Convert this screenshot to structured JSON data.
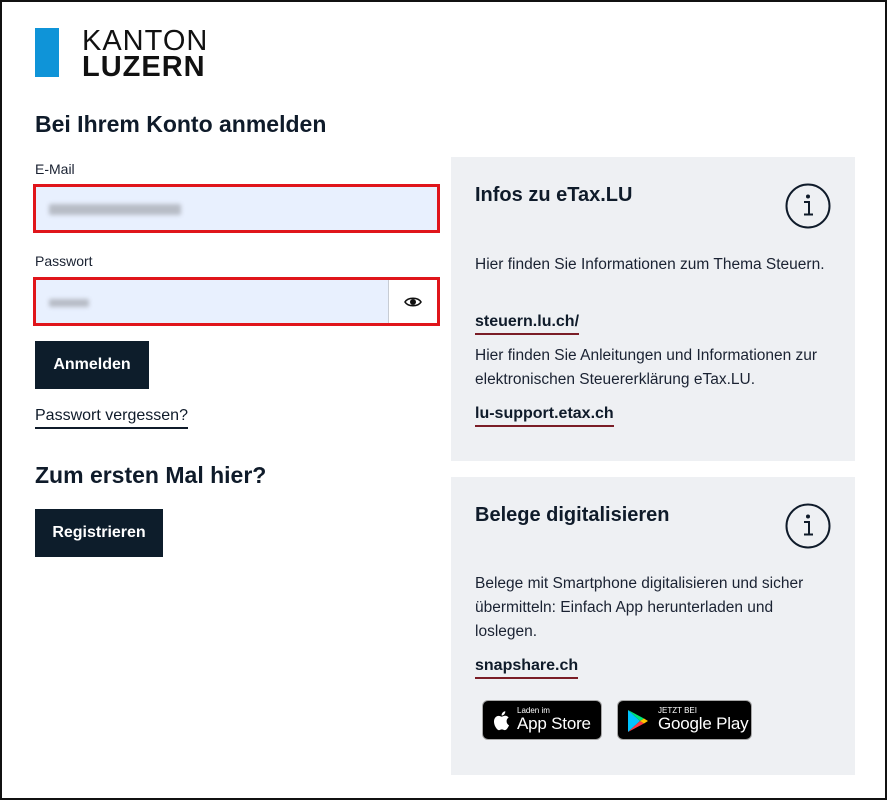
{
  "logo": {
    "line1": "KANTON",
    "line2": "LUZERN",
    "brand_color": "#0f94d8"
  },
  "login": {
    "title": "Bei Ihrem Konto anmelden",
    "email_label": "E-Mail",
    "password_label": "Passwort",
    "submit_label": "Anmelden",
    "forgot_label": "Passwort vergessen?",
    "error_border_color": "#e0151b"
  },
  "register": {
    "title": "Zum ersten Mal hier?",
    "button_label": "Registrieren"
  },
  "info_card": {
    "title": "Infos zu eTax.LU",
    "text1": "Hier finden Sie Informationen zum Thema Steuern.",
    "link1": "steuern.lu.ch/",
    "text2": "Hier finden Sie Anleitungen und Informationen zur elektronischen Steuererklärung eTax.LU.",
    "link2": "lu-support.etax.ch"
  },
  "belege_card": {
    "title": "Belege digitalisieren",
    "text": "Belege mit Smartphone digitalisieren und sicher übermitteln: Einfach App herunterladen und loslegen.",
    "link": "snapshare.ch",
    "appstore_small": "Laden im",
    "appstore_big": "App Store",
    "googleplay_small": "JETZT BEI",
    "googleplay_big": "Google Play"
  }
}
